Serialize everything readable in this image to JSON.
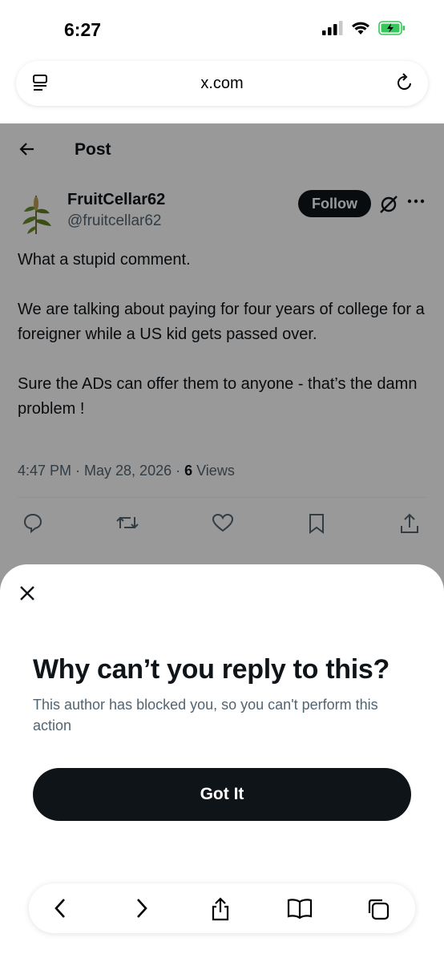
{
  "status_bar": {
    "time": "6:27"
  },
  "browser": {
    "url": "x.com"
  },
  "post_header": {
    "title": "Post"
  },
  "tweet": {
    "author_name": "FruitCellar62",
    "author_handle": "@fruitcellar62",
    "follow_label": "Follow",
    "text": "What a stupid comment.\n\nWe are talking about paying for four years of college for a foreigner while a US kid gets passed over.\n\nSure the ADs can offer them to anyone - that’s the damn problem !",
    "timestamp": "4:47 PM · May 28, 2026 · ",
    "views_count": "6",
    "views_label": " Views"
  },
  "sheet": {
    "title": "Why can’t you reply to this?",
    "body": "This author has blocked you, so you can't perform this action",
    "button_label": "Got It"
  },
  "icons": {
    "reader": "reader-icon",
    "reload": "reload-icon",
    "back": "back-arrow-icon",
    "grok": "grok-icon",
    "more": "more-icon",
    "reply": "reply-icon",
    "retweet": "retweet-icon",
    "like": "like-icon",
    "bookmark": "bookmark-icon",
    "share": "share-icon",
    "close": "close-icon"
  },
  "colors": {
    "accent_dark": "#0f1419",
    "secondary_text": "#536471",
    "battery_green": "#34c759"
  }
}
